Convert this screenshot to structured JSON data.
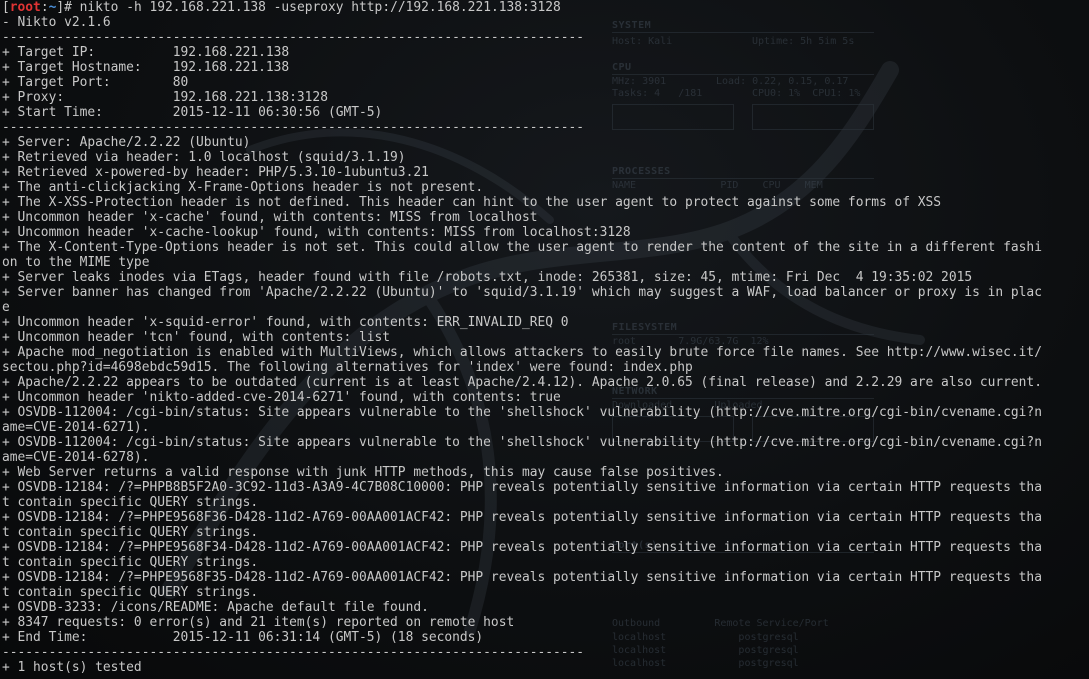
{
  "prompt": {
    "user": "root",
    "path": "~",
    "command": "nikto -h 192.168.221.138 -useproxy http://192.168.221.138:3128"
  },
  "version_line": "- Nikto v2.1.6",
  "separator": "---------------------------------------------------------------------------",
  "target_block": [
    "+ Target IP:          192.168.221.138",
    "+ Target Hostname:    192.168.221.138",
    "+ Target Port:        80",
    "+ Proxy:              192.168.221.138:3128",
    "+ Start Time:         2015-12-11 06:30:56 (GMT-5)"
  ],
  "findings": [
    "+ Server: Apache/2.2.22 (Ubuntu)",
    "+ Retrieved via header: 1.0 localhost (squid/3.1.19)",
    "+ Retrieved x-powered-by header: PHP/5.3.10-1ubuntu3.21",
    "+ The anti-clickjacking X-Frame-Options header is not present.",
    "+ The X-XSS-Protection header is not defined. This header can hint to the user agent to protect against some forms of XSS",
    "+ Uncommon header 'x-cache' found, with contents: MISS from localhost",
    "+ Uncommon header 'x-cache-lookup' found, with contents: MISS from localhost:3128",
    "+ The X-Content-Type-Options header is not set. This could allow the user agent to render the content of the site in a different fashi",
    "on to the MIME type",
    "+ Server leaks inodes via ETags, header found with file /robots.txt, inode: 265381, size: 45, mtime: Fri Dec  4 19:35:02 2015",
    "+ Server banner has changed from 'Apache/2.2.22 (Ubuntu)' to 'squid/3.1.19' which may suggest a WAF, load balancer or proxy is in plac",
    "e",
    "+ Uncommon header 'x-squid-error' found, with contents: ERR_INVALID_REQ 0",
    "+ Uncommon header 'tcn' found, with contents: list",
    "+ Apache mod_negotiation is enabled with MultiViews, which allows attackers to easily brute force file names. See http://www.wisec.it/",
    "sectou.php?id=4698ebdc59d15. The following alternatives for 'index' were found: index.php",
    "+ Apache/2.2.22 appears to be outdated (current is at least Apache/2.4.12). Apache 2.0.65 (final release) and 2.2.29 are also current.",
    "+ Uncommon header 'nikto-added-cve-2014-6271' found, with contents: true",
    "+ OSVDB-112004: /cgi-bin/status: Site appears vulnerable to the 'shellshock' vulnerability (http://cve.mitre.org/cgi-bin/cvename.cgi?n",
    "ame=CVE-2014-6271).",
    "+ OSVDB-112004: /cgi-bin/status: Site appears vulnerable to the 'shellshock' vulnerability (http://cve.mitre.org/cgi-bin/cvename.cgi?n",
    "ame=CVE-2014-6278).",
    "+ Web Server returns a valid response with junk HTTP methods, this may cause false positives.",
    "+ OSVDB-12184: /?=PHPB8B5F2A0-3C92-11d3-A3A9-4C7B08C10000: PHP reveals potentially sensitive information via certain HTTP requests tha",
    "t contain specific QUERY strings.",
    "+ OSVDB-12184: /?=PHPE9568F36-D428-11d2-A769-00AA001ACF42: PHP reveals potentially sensitive information via certain HTTP requests tha",
    "t contain specific QUERY strings.",
    "+ OSVDB-12184: /?=PHPE9568F34-D428-11d2-A769-00AA001ACF42: PHP reveals potentially sensitive information via certain HTTP requests tha",
    "t contain specific QUERY strings.",
    "+ OSVDB-12184: /?=PHPE9568F35-D428-11d2-A769-00AA001ACF42: PHP reveals potentially sensitive information via certain HTTP requests tha",
    "t contain specific QUERY strings.",
    "+ OSVDB-3233: /icons/README: Apache default file found.",
    "+ 8347 requests: 0 error(s) and 21 item(s) reported on remote host",
    "+ End Time:           2015-12-11 06:31:14 (GMT-5) (18 seconds)"
  ],
  "summary_line": "+ 1 host(s) tested",
  "conky": {
    "system_title": "SYSTEM",
    "host": "Host: Kali",
    "uptime": "Uptime: 5h 5im 5s",
    "cpu_title": "CPU",
    "mhz": "MHz: 3901",
    "load": "Load: 0.22, 0.15, 0.17",
    "tasks": "Tasks: 4   /181",
    "cpu_cores": "CPU0: 1%  CPU1: 1%",
    "processes_title": "PROCESSES",
    "proc_header": "NAME              PID    CPU    MEM",
    "filesystem_title": "FILESYSTEM",
    "fs_root": "root       7.9G/63.7G  12%",
    "network_title": "NETWORK",
    "net_header": "Downloaded       Uploaded",
    "port_title": "Port(s)",
    "outbound_title": "Outbound         Remote Service/Port",
    "net_rows": [
      "localhost            postgresql",
      "localhost            postgresql",
      "localhost            postgresql"
    ]
  }
}
